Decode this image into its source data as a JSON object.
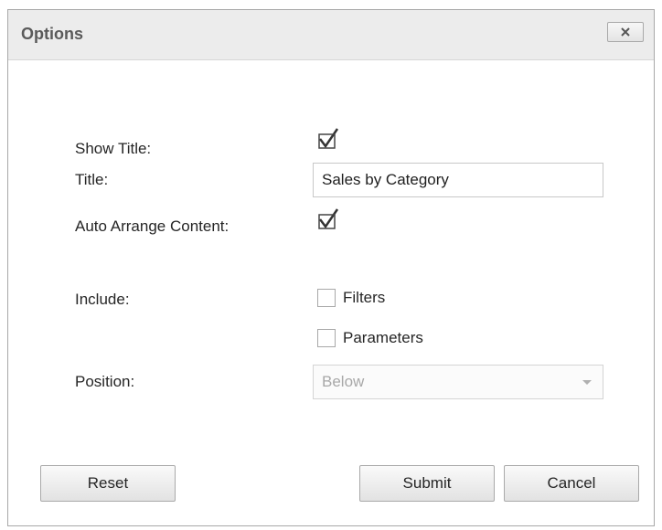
{
  "dialog": {
    "title": "Options",
    "close_icon": "close-icon"
  },
  "form": {
    "show_title_label": "Show Title:",
    "show_title_checked": true,
    "title_label": "Title:",
    "title_value": "Sales by Category",
    "auto_arrange_label": "Auto Arrange Content:",
    "auto_arrange_checked": true,
    "include_label": "Include:",
    "include_options": [
      {
        "label": "Filters",
        "checked": false
      },
      {
        "label": "Parameters",
        "checked": false
      }
    ],
    "position_label": "Position:",
    "position_value": "Below"
  },
  "buttons": {
    "reset": "Reset",
    "submit": "Submit",
    "cancel": "Cancel"
  }
}
